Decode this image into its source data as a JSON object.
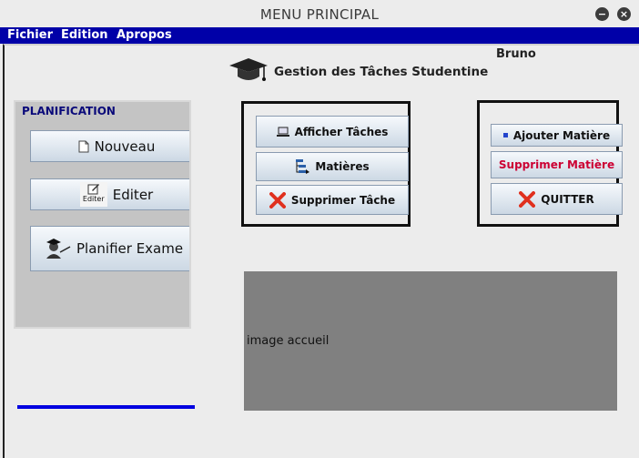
{
  "window": {
    "title": "MENU PRINCIPAL",
    "minimize_glyph": "−",
    "close_glyph": "×"
  },
  "menubar": {
    "items": [
      "Fichier",
      "Edition",
      "Apropos"
    ]
  },
  "header": {
    "user": "Bruno",
    "app_title": "Gestion des Tâches Studentine",
    "app_icon": "graduation-cap-icon"
  },
  "planification": {
    "title": "PLANIFICATION",
    "buttons": [
      {
        "label": "Nouveau",
        "icon": "document-icon"
      },
      {
        "label": "Editer",
        "icon": "edit-icon",
        "icon_text": "Editer"
      },
      {
        "label": "Planifier Exame",
        "icon": "teacher-icon"
      }
    ]
  },
  "tasks_panel": {
    "buttons": [
      {
        "label": "Afficher Tâches",
        "icon": "computer-icon"
      },
      {
        "label": "Matières",
        "icon": "tree-icon"
      },
      {
        "label": "Supprimer Tâche",
        "icon": "red-x-icon"
      }
    ]
  },
  "subjects_panel": {
    "buttons": [
      {
        "label": "Ajouter Matière",
        "icon": "blue-square-icon"
      },
      {
        "label": "Supprimer Matière"
      },
      {
        "label": "QUITTER",
        "icon": "red-x-icon"
      }
    ]
  },
  "image_panel": {
    "label": "image accueil"
  },
  "colors": {
    "menubar": "#0000a8",
    "delete_subject_text": "#cc0033",
    "accent_line": "#0000e0"
  }
}
